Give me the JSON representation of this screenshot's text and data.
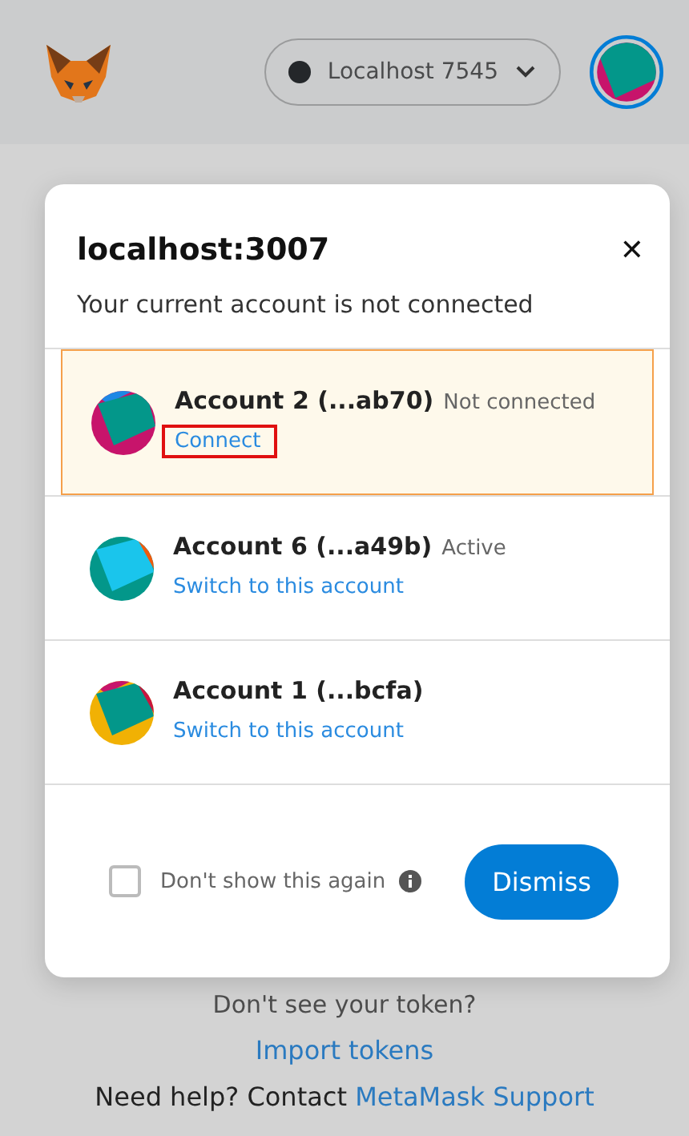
{
  "header": {
    "network": {
      "label": "Localhost 7545",
      "color": "#24272a"
    }
  },
  "dialog": {
    "title": "localhost:3007",
    "close": "✕",
    "subtitle": "Your current account is not connected",
    "accounts": [
      {
        "name": "Account 2 (...ab70)",
        "status": "Not connected",
        "action": "Connect",
        "selected": true,
        "annotated": true,
        "color": "#c7146b"
      },
      {
        "name": "Account 6 (...a49b)",
        "status": "Active",
        "action": "Switch to this account",
        "selected": false,
        "annotated": false,
        "color": "#03978a"
      },
      {
        "name": "Account 1 (...bcfa)",
        "action": "Switch to this account",
        "selected": false,
        "annotated": false,
        "color": "#f1b104"
      }
    ],
    "dont_show": {
      "label": "Don't show this again",
      "checked": false
    },
    "dismiss": "Dismiss"
  },
  "page": {
    "token_prompt": "Don't see your token?",
    "import_link": "Import tokens",
    "help_text": "Need help? Contact ",
    "help_link": "MetaMask Support"
  }
}
